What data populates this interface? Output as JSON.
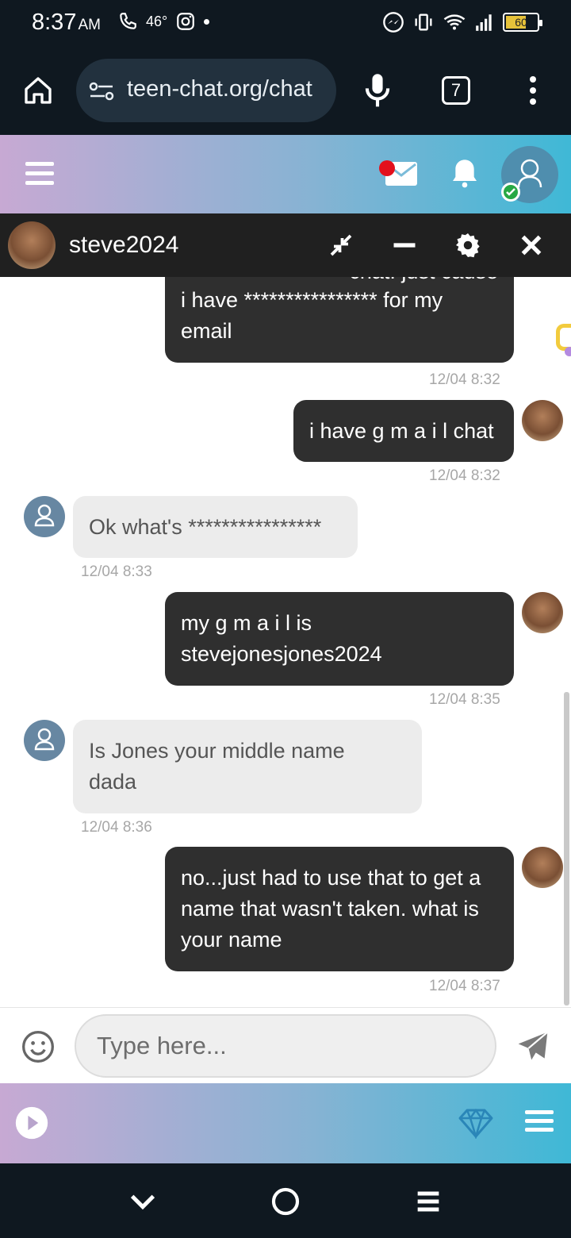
{
  "status_bar": {
    "time": "8:37",
    "ampm": "AM",
    "temperature": "46°",
    "battery": "60"
  },
  "browser": {
    "url": "teen-chat.org/chat",
    "tab_count": "7"
  },
  "chat": {
    "contact_name": "steve2024",
    "input_placeholder": "Type here..."
  },
  "messages": [
    {
      "direction": "out",
      "text": "i have **************** for my email",
      "partial_top": "chat. just cause",
      "time": "12/04 8:32"
    },
    {
      "direction": "out",
      "text": "i have g m a i l chat",
      "time": "12/04 8:32"
    },
    {
      "direction": "in",
      "text": "Ok what's ****************",
      "time": "12/04 8:33"
    },
    {
      "direction": "out",
      "text": "my g m a i l is stevejonesjones2024",
      "time": "12/04 8:35"
    },
    {
      "direction": "in",
      "text": "Is Jones your middle name dada",
      "time": "12/04 8:36"
    },
    {
      "direction": "out",
      "text": "no...just had to use that to get a name that wasn't taken. what is your name",
      "time": "12/04 8:37"
    }
  ],
  "colors": {
    "system_bg": "#0f1820",
    "gradient_start": "#c7a9d3",
    "gradient_end": "#3fb8d6",
    "outgoing_bubble": "#2f2f2f",
    "incoming_bubble": "#ececec",
    "notification_dot": "#e3101c",
    "online": "#27a844"
  }
}
